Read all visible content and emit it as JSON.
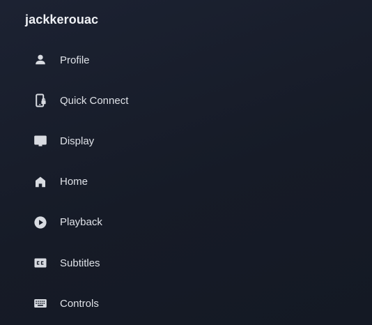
{
  "user": {
    "name": "jackkerouac"
  },
  "menu": {
    "items": [
      {
        "label": "Profile",
        "icon": "person-icon"
      },
      {
        "label": "Quick Connect",
        "icon": "phone-lock-icon"
      },
      {
        "label": "Display",
        "icon": "monitor-icon"
      },
      {
        "label": "Home",
        "icon": "home-icon"
      },
      {
        "label": "Playback",
        "icon": "play-circle-icon"
      },
      {
        "label": "Subtitles",
        "icon": "closed-caption-icon"
      },
      {
        "label": "Controls",
        "icon": "keyboard-icon"
      }
    ]
  },
  "colors": {
    "background": "#181d2a",
    "text": "#dfe2e8",
    "icon": "#d8dbe1"
  }
}
